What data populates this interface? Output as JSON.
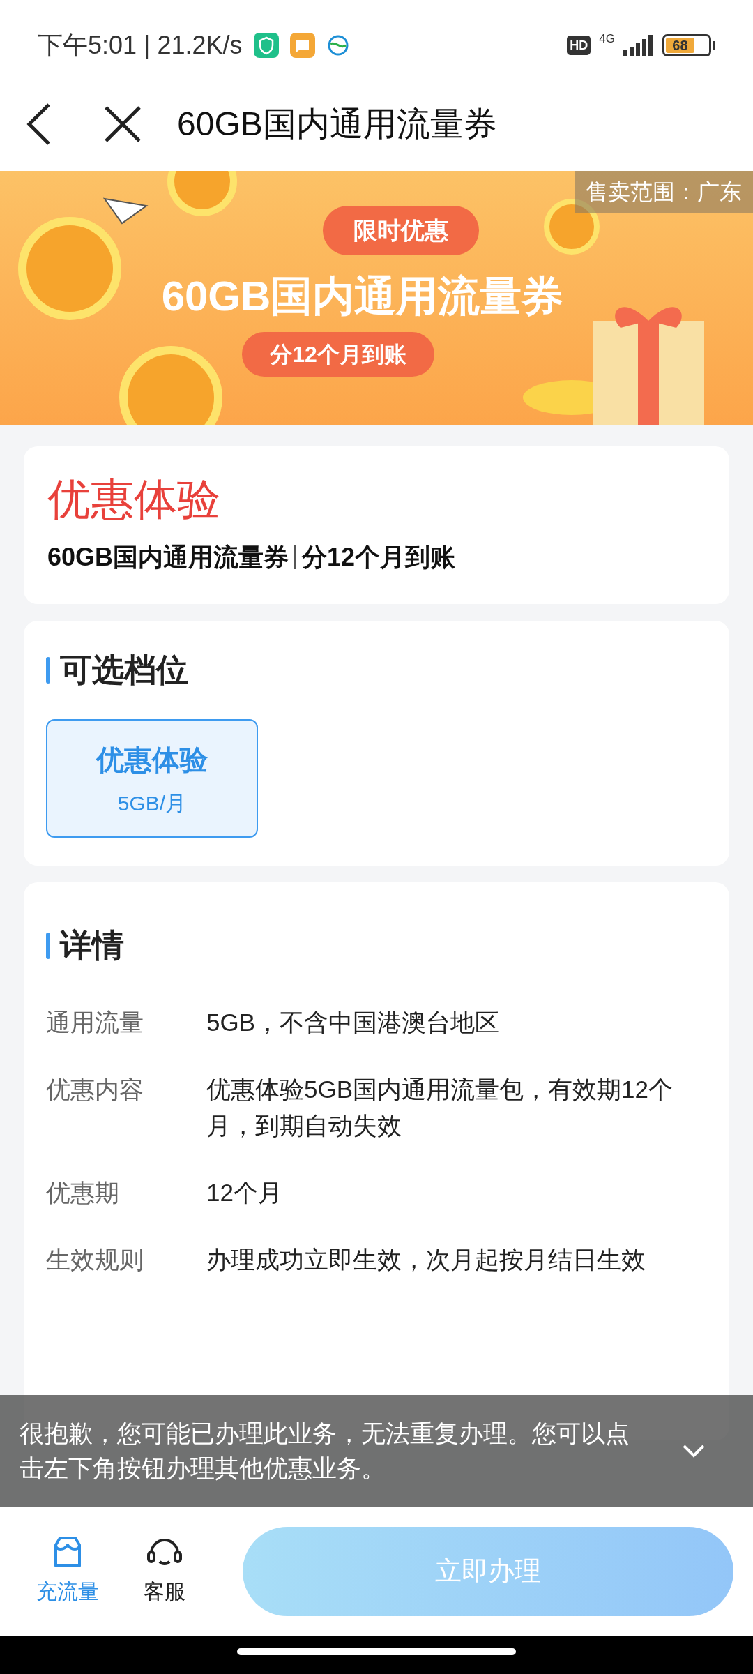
{
  "status_bar": {
    "time": "下午5:01 | 21.2K/s",
    "hd": "HD",
    "network": "4G",
    "battery": "68"
  },
  "header": {
    "title": "60GB国内通用流量券"
  },
  "banner": {
    "tag": "限时优惠",
    "headline": "60GB国内通用流量券",
    "subline": "分12个月到账",
    "region": "售卖范围：广东"
  },
  "offer": {
    "name": "优惠体验",
    "product": "60GB国内通用流量券",
    "note": "分12个月到账"
  },
  "tiers": {
    "title": "可选档位",
    "items": [
      {
        "name": "优惠体验",
        "size": "5GB/月",
        "selected": true
      }
    ]
  },
  "details": {
    "title": "详情",
    "rows": [
      {
        "label": "通用流量",
        "value": "5GB，不含中国港澳台地区"
      },
      {
        "label": "优惠内容",
        "value": "优惠体验5GB国内通用流量包，有效期12个月，到期自动失效"
      },
      {
        "label": "优惠期",
        "value": "12个月"
      },
      {
        "label": "生效规则",
        "value": "办理成功立即生效，次月起按月结日生效"
      }
    ]
  },
  "toast": {
    "message": "很抱歉，您可能已办理此业务，无法重复办理。您可以点击左下角按钮办理其他优惠业务。"
  },
  "bottom_bar": {
    "tabs": [
      {
        "label": "充流量",
        "selected": true
      },
      {
        "label": "客服",
        "selected": false
      }
    ],
    "action": "立即办理"
  }
}
